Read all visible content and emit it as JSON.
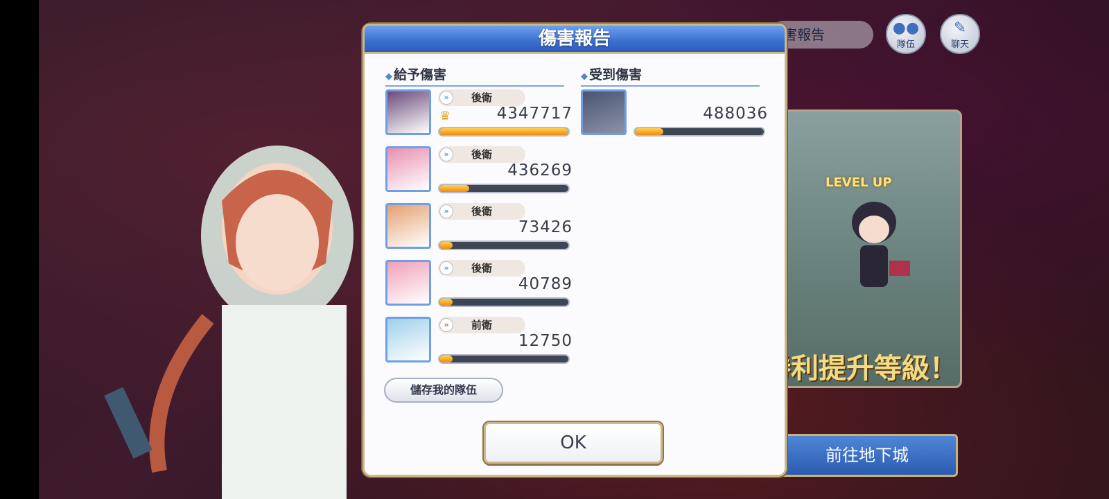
{
  "dialog": {
    "title": "傷害報告",
    "given_title": "給予傷害",
    "received_title": "受到傷害",
    "save_label": "儲存我的隊伍",
    "ok_label": "OK"
  },
  "given": [
    {
      "role": "後衛",
      "role_type": "back",
      "damage": "4347717",
      "fill": 1.0,
      "crown": true,
      "avatar_color": "#6b4b7a"
    },
    {
      "role": "後衛",
      "role_type": "back",
      "damage": "436269",
      "fill": 0.23,
      "crown": false,
      "avatar_color": "#e78fb0"
    },
    {
      "role": "後衛",
      "role_type": "back",
      "damage": "73426",
      "fill": 0.1,
      "crown": false,
      "avatar_color": "#e3a070"
    },
    {
      "role": "後衛",
      "role_type": "back",
      "damage": "40789",
      "fill": 0.1,
      "crown": false,
      "avatar_color": "#f0a0b8"
    },
    {
      "role": "前衛",
      "role_type": "front",
      "damage": "12750",
      "fill": 0.1,
      "crown": false,
      "avatar_color": "#9fd0ea"
    }
  ],
  "received": [
    {
      "damage": "488036",
      "fill": 0.22,
      "avatar_color": "#4a5470"
    }
  ],
  "hud": {
    "report_pill": "害報告",
    "team_label": "隊伍",
    "chat_label": "聊天",
    "level_up": "LEVEL UP",
    "level_text": "勝利提升等級！",
    "dungeon_label": "前往地下城"
  }
}
